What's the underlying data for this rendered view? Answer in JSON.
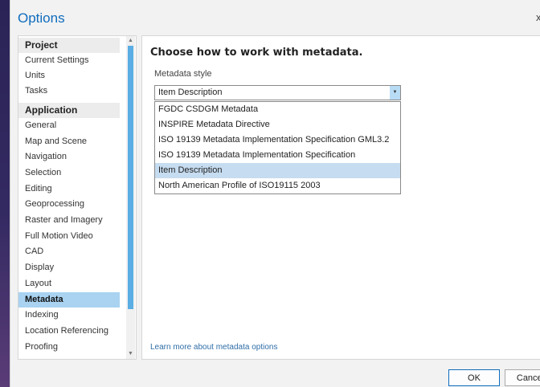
{
  "window": {
    "title": "Options",
    "close_glyph": "x"
  },
  "sidebar": {
    "groups": [
      {
        "header": "Project",
        "items": [
          "Current Settings",
          "Units",
          "Tasks"
        ]
      },
      {
        "header": "Application",
        "items": [
          "General",
          "Map and Scene",
          "Navigation",
          "Selection",
          "Editing",
          "Geoprocessing",
          "Raster and Imagery",
          "Full Motion Video",
          "CAD",
          "Display",
          "Layout",
          "Metadata",
          "Indexing",
          "Location Referencing",
          "Proofing"
        ]
      }
    ],
    "selected": "Metadata"
  },
  "content": {
    "heading": "Choose how to work with metadata.",
    "metadata_style_label": "Metadata style",
    "selected_style": "Item Description",
    "options": [
      "FGDC CSDGM Metadata",
      "INSPIRE Metadata Directive",
      "ISO 19139 Metadata Implementation Specification GML3.2",
      "ISO 19139 Metadata Implementation Specification",
      "Item Description",
      "North American Profile of ISO19115 2003"
    ],
    "highlighted_option": "Item Description",
    "learn_more": "Learn more about metadata options"
  },
  "buttons": {
    "ok": "OK",
    "cancel": "Cancel"
  },
  "colors": {
    "accent": "#0f6cbd",
    "selection": "#a9d3f1",
    "dropdown_highlight": "#c6dcf0"
  }
}
